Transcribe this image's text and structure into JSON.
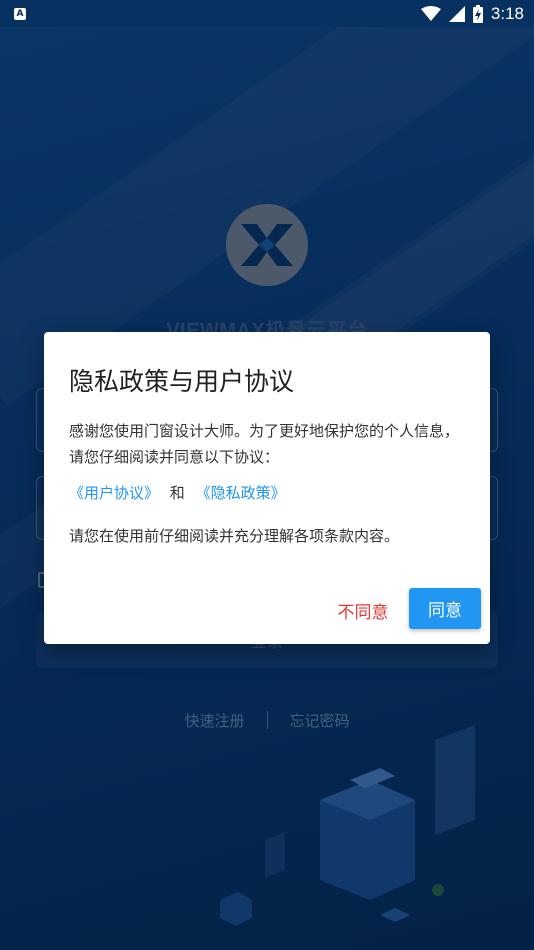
{
  "status_bar": {
    "notification_icon": "A",
    "time": "3:18",
    "icons": [
      "wifi-icon",
      "signal-icon",
      "battery-charging-icon"
    ]
  },
  "app": {
    "brand_title": "VIEWMAX极景云平台",
    "login_label": "登录",
    "register_link": "快速注册",
    "forgot_link": "忘记密码"
  },
  "dialog": {
    "title": "隐私政策与用户协议",
    "body": "感谢您使用门窗设计大师。为了更好地保护您的个人信息，请您仔细阅读并同意以下协议：",
    "user_agreement_link": "《用户协议》",
    "conjunction": "和",
    "privacy_policy_link": "《隐私政策》",
    "note": "请您在使用前仔细阅读并充分理解各项条款内容。",
    "disagree_label": "不同意",
    "agree_label": "同意"
  },
  "colors": {
    "background": "#0b3f78",
    "link": "#2196f3",
    "agree": "#2196f3",
    "disagree": "#e53935"
  }
}
